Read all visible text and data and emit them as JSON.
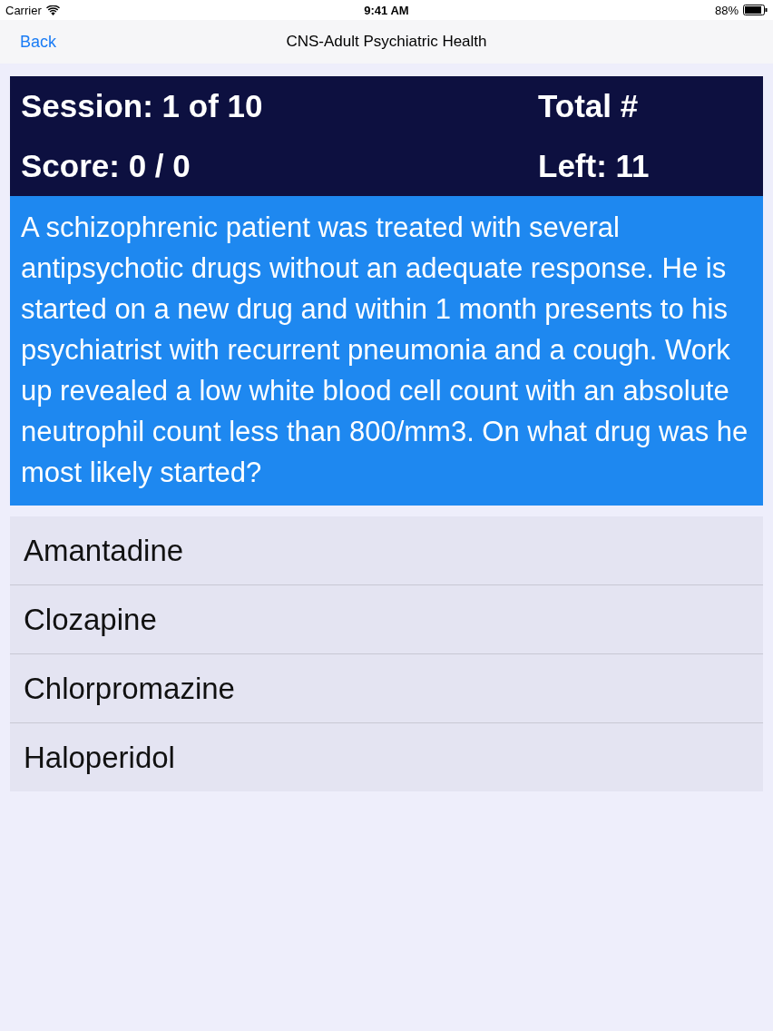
{
  "status_bar": {
    "carrier": "Carrier",
    "time": "9:41 AM",
    "battery": "88%"
  },
  "nav": {
    "back": "Back",
    "title": "CNS-Adult Psychiatric Health"
  },
  "header": {
    "session": "Session: 1 of 10",
    "total": "Total #",
    "score": "Score: 0 / 0",
    "left": "Left: 11"
  },
  "question": "A schizophrenic patient was treated with several antipsychotic drugs without an adequate response. He is started on a new drug and within 1 month presents to his psychiatrist with recurrent pneumonia and a cough. Work up revealed a low white blood cell count with an absolute neutrophil count less than 800/mm3. On what drug was he most likely started?",
  "answers": [
    {
      "label": "Amantadine"
    },
    {
      "label": "Clozapine"
    },
    {
      "label": "Chlorpromazine"
    },
    {
      "label": "Haloperidol"
    }
  ]
}
